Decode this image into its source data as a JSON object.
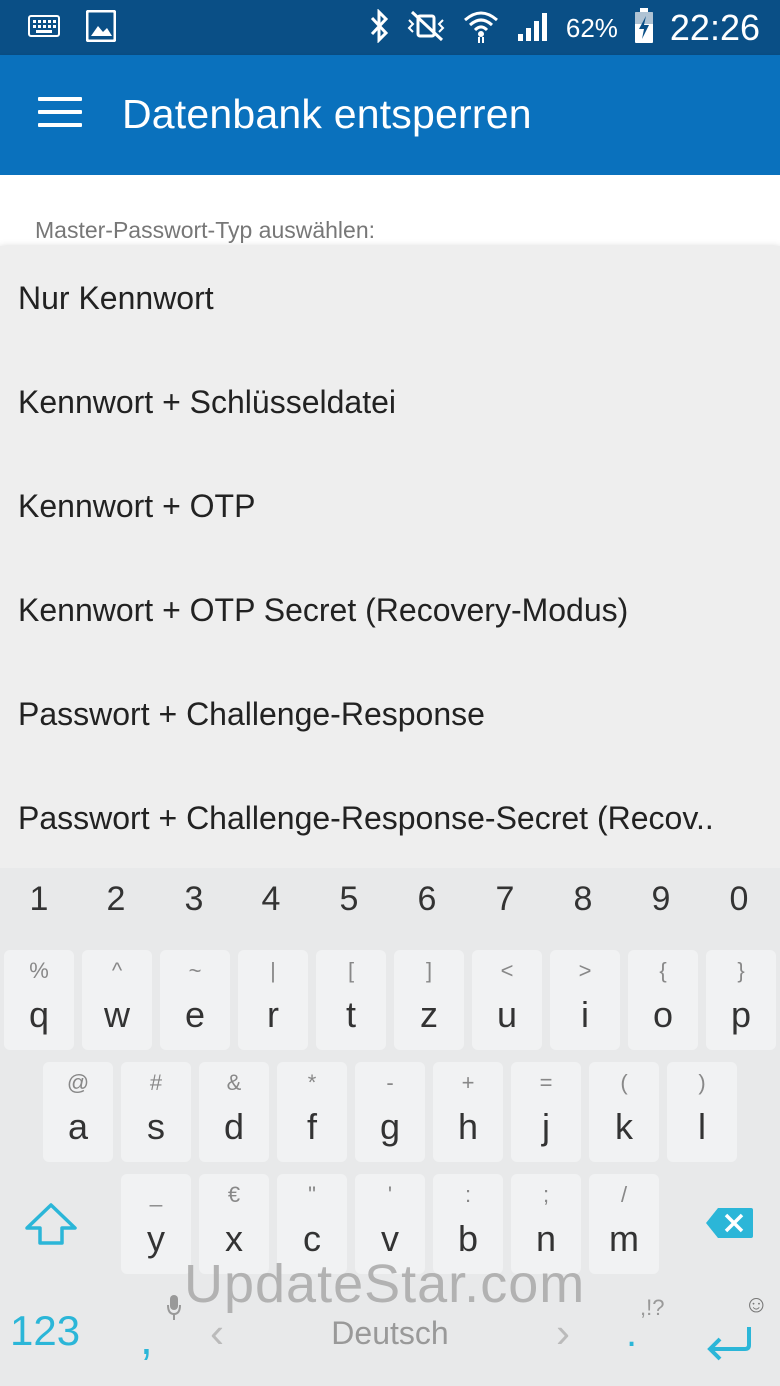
{
  "status_bar": {
    "battery": "62%",
    "time": "22:26",
    "icons": [
      "keyboard-icon",
      "image-icon",
      "bluetooth-icon",
      "mute-vibrate-icon",
      "wifi-icon",
      "signal-icon",
      "battery-charging-icon"
    ]
  },
  "app_bar": {
    "title": "Datenbank entsperren",
    "menu_icon": "hamburger-menu-icon"
  },
  "content": {
    "label": "Master-Passwort-Typ auswählen:"
  },
  "dropdown": {
    "options": [
      "Nur Kennwort",
      "Kennwort + Schlüsseldatei",
      "Kennwort + OTP",
      "Kennwort + OTP Secret (Recovery-Modus)",
      "Passwort + Challenge-Response",
      "Passwort + Challenge-Response-Secret (Recov.."
    ]
  },
  "keyboard": {
    "numbers": [
      "1",
      "2",
      "3",
      "4",
      "5",
      "6",
      "7",
      "8",
      "9",
      "0"
    ],
    "row1": [
      {
        "main": "q",
        "hint": "%"
      },
      {
        "main": "w",
        "hint": "^"
      },
      {
        "main": "e",
        "hint": "~"
      },
      {
        "main": "r",
        "hint": "|"
      },
      {
        "main": "t",
        "hint": "["
      },
      {
        "main": "z",
        "hint": "]"
      },
      {
        "main": "u",
        "hint": "<"
      },
      {
        "main": "i",
        "hint": ">"
      },
      {
        "main": "o",
        "hint": "{"
      },
      {
        "main": "p",
        "hint": "}"
      }
    ],
    "row2": [
      {
        "main": "a",
        "hint": "@"
      },
      {
        "main": "s",
        "hint": "#"
      },
      {
        "main": "d",
        "hint": "&"
      },
      {
        "main": "f",
        "hint": "*"
      },
      {
        "main": "g",
        "hint": "-"
      },
      {
        "main": "h",
        "hint": "+"
      },
      {
        "main": "j",
        "hint": "="
      },
      {
        "main": "k",
        "hint": "("
      },
      {
        "main": "l",
        "hint": ")"
      }
    ],
    "row3": [
      {
        "main": "y",
        "hint": "_"
      },
      {
        "main": "x",
        "hint": "€"
      },
      {
        "main": "c",
        "hint": "\""
      },
      {
        "main": "v",
        "hint": "'"
      },
      {
        "main": "b",
        "hint": ":"
      },
      {
        "main": "n",
        "hint": ";"
      },
      {
        "main": "m",
        "hint": "/"
      }
    ],
    "mode_key": "123",
    "comma": ",",
    "space_label": "Deutsch",
    "period": ".",
    "period_hint": ",!?",
    "accent_color": "#2bb6d8"
  },
  "watermark": "UpdateStar.com"
}
